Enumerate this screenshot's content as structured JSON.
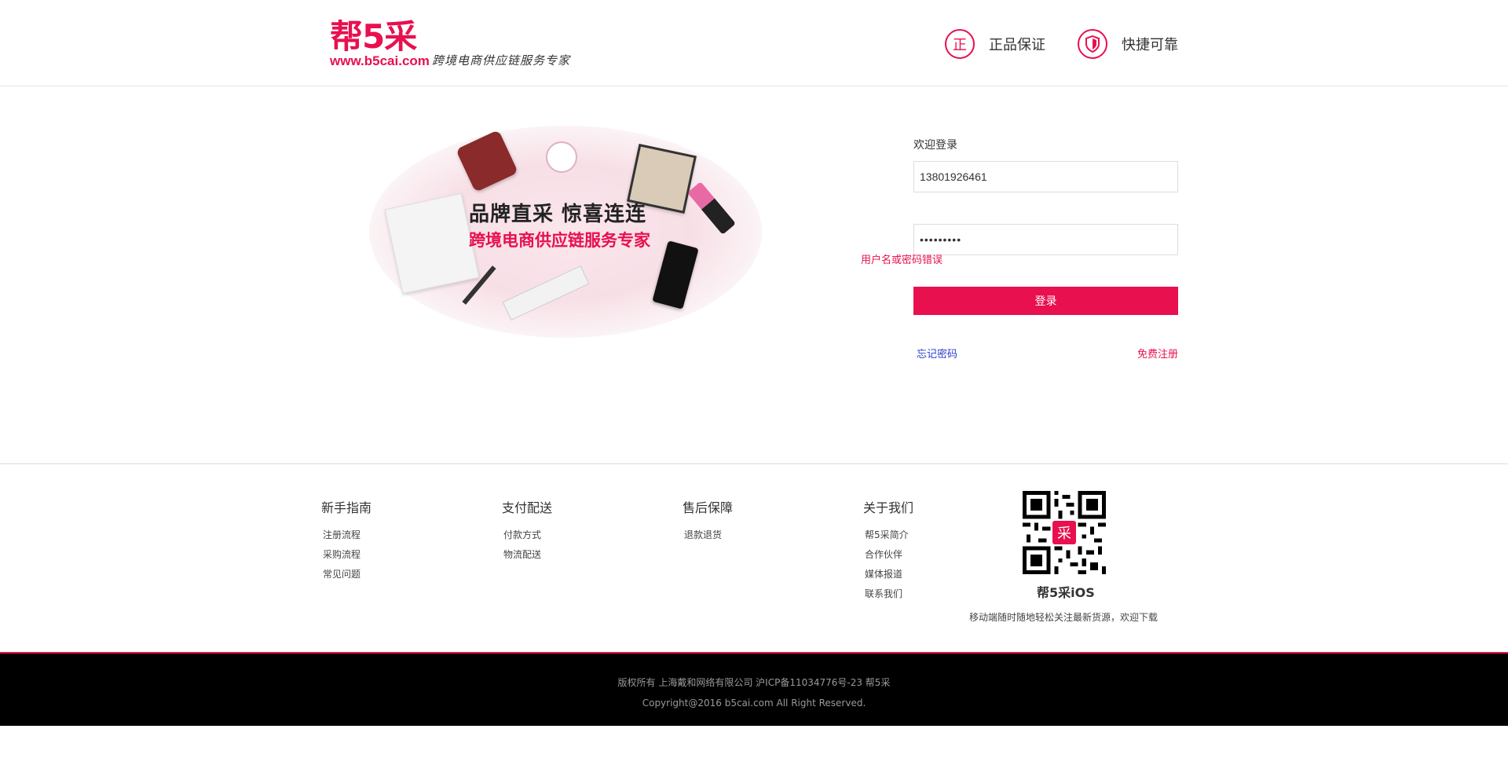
{
  "header": {
    "logo_main": "帮5采",
    "logo_url": "www.b5cai.com",
    "slogan": "跨境电商供应链服务专家",
    "badges": [
      {
        "icon_char": "正",
        "icon": "genuine-icon",
        "label": "正品保证"
      },
      {
        "icon": "shield-icon",
        "label": "快捷可靠"
      }
    ]
  },
  "banner": {
    "line1": "品牌直采  惊喜连连",
    "line2": "跨境电商供应链服务专家"
  },
  "login": {
    "title": "欢迎登录",
    "username_value": "13801926461",
    "password_value": "•••••••••",
    "error": "用户名或密码错误",
    "submit_label": "登录",
    "forgot_label": "忘记密码",
    "register_label": "免费注册"
  },
  "footer": {
    "columns": [
      {
        "title": "新手指南",
        "links": [
          "注册流程",
          "采购流程",
          "常见问题"
        ]
      },
      {
        "title": "支付配送",
        "links": [
          "付款方式",
          "物流配送"
        ]
      },
      {
        "title": "售后保障",
        "links": [
          "退款退货"
        ]
      },
      {
        "title": "关于我们",
        "links": [
          "帮5采简介",
          "合作伙伴",
          "媒体报道",
          "联系我们"
        ]
      }
    ],
    "qr_center_char": "采",
    "app_name": "帮5采iOS",
    "app_desc": "移动端随时随地轻松关注最新货源，欢迎下载",
    "copyright_line1": "版权所有 上海戴和网络有限公司 沪ICP备11034776号-23 帮5采",
    "copyright_line2": "Copyright@2016 b5cai.com All Right Reserved."
  },
  "colors": {
    "brand": "#e8104f",
    "link_blue": "#2c3fc8",
    "footer_bg": "#000000"
  }
}
